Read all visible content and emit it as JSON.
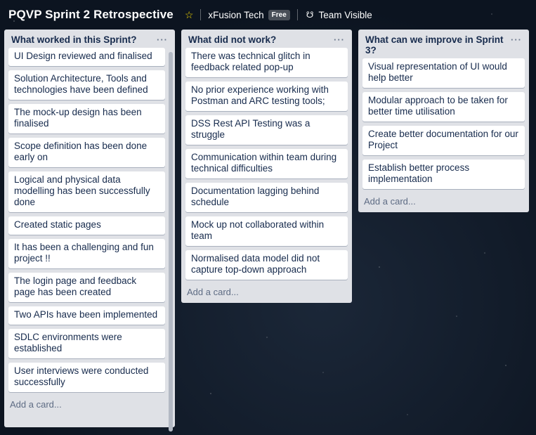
{
  "header": {
    "board_title": "PQVP Sprint 2 Retrospective",
    "team_name": "xFusion Tech",
    "team_badge": "Free",
    "visibility": "Team Visible"
  },
  "lists": [
    {
      "title": "What worked in this Sprint?",
      "menu": "···",
      "cards": [
        "UI Design reviewed and finalised",
        "Solution Architecture, Tools and technologies have been defined",
        "The mock-up design has been finalised",
        "Scope definition has been done early on",
        "Logical and physical data modelling has been successfully done",
        "Created static pages",
        "It has been a challenging and fun project !!",
        "The login page and feedback page has been created",
        "Two APIs have been implemented",
        "SDLC environments were established",
        "User interviews were conducted successfully"
      ],
      "add_card": "Add a card..."
    },
    {
      "title": "What did not work?",
      "menu": "···",
      "cards": [
        "There was technical glitch in feedback related pop-up",
        "No prior experience working with Postman and ARC testing tools;",
        "DSS Rest API Testing was a struggle",
        "Communication within team during technical difficulties",
        "Documentation lagging behind schedule",
        "Mock up not collaborated within team",
        "Normalised data model did not capture top-down approach"
      ],
      "add_card": "Add a card..."
    },
    {
      "title": "What can we improve in Sprint 3?",
      "menu": "···",
      "cards": [
        "Visual representation of UI would help better",
        "Modular approach to be taken for better time utilisation",
        "Create better documentation for our Project",
        "Establish better process implementation"
      ],
      "add_card": "Add a card..."
    }
  ]
}
